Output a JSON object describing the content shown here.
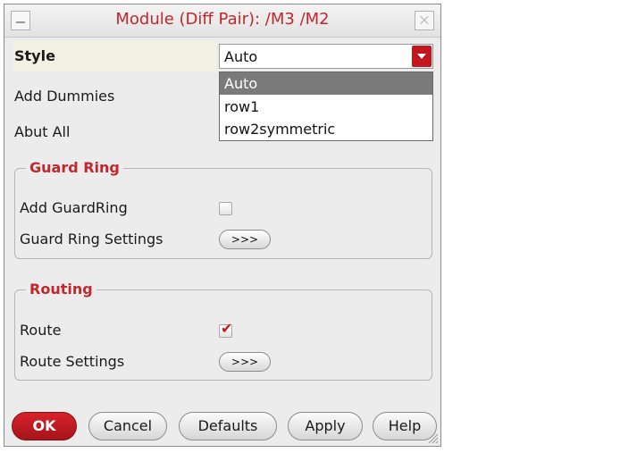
{
  "window": {
    "title": "Module (Diff Pair): /M3 /M2"
  },
  "style": {
    "label": "Style",
    "value": "Auto",
    "options": [
      "Auto",
      "row1",
      "row2symmetric"
    ]
  },
  "add_dummies": {
    "label": "Add Dummies"
  },
  "abut_all": {
    "label": "Abut All"
  },
  "guard_ring": {
    "title": "Guard Ring",
    "add_label": "Add GuardRing",
    "add_checked": false,
    "settings_label": "Guard Ring Settings",
    "settings_button": ">>>"
  },
  "routing": {
    "title": "Routing",
    "route_label": "Route",
    "route_checked": true,
    "settings_label": "Route Settings",
    "settings_button": ">>>"
  },
  "buttons": {
    "ok": "OK",
    "cancel": "Cancel",
    "defaults": "Defaults",
    "apply": "Apply",
    "help": "Help"
  },
  "colors": {
    "accent": "#c4161c",
    "title_text": "#c0282e",
    "dialog_bg": "#ececec"
  }
}
